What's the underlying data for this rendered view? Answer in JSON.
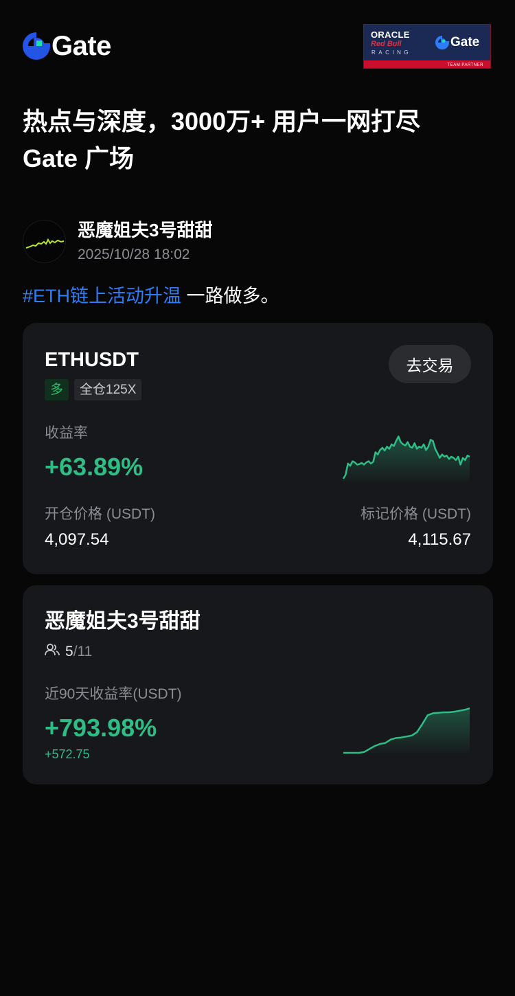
{
  "brand": {
    "name": "Gate",
    "logo_icon": "gate-logo-icon",
    "accent": "#2354e6",
    "accent2": "#17e2ae"
  },
  "partner": {
    "line1": "ORACLE",
    "line2": "Red Bull",
    "line3": "RACING",
    "brand": "Gate",
    "tagline": "TEAM PARTNER"
  },
  "headline": {
    "line1": "热点与深度，3000万+ 用户一网打尽",
    "line2": "Gate 广场"
  },
  "post": {
    "author": "恶魔姐夫3号甜甜",
    "time": "2025/10/28 18:02",
    "hashtag": "#ETH链上活动升温",
    "text": " 一路做多。"
  },
  "position_card": {
    "pair": "ETHUSDT",
    "trade_button": "去交易",
    "side_tag": "多",
    "leverage_tag": "全仓125X",
    "roi_label": "收益率",
    "roi": "+63.89%",
    "entry_label": "开仓价格 (USDT)",
    "entry_price": "4,097.54",
    "mark_label": "标记价格 (USDT)",
    "mark_price": "4,115.67"
  },
  "trader_card": {
    "name": "恶魔姐夫3号甜甜",
    "members_current": "5",
    "members_total": "/11",
    "members_icon": "users-icon",
    "roi_label": "近90天收益率(USDT)",
    "roi": "+793.98%",
    "pnl": "+572.75"
  },
  "colors": {
    "green": "#2ebd85",
    "link": "#2e7cf6",
    "card": "#17181b",
    "bg": "#070708"
  },
  "chart_data": [
    {
      "type": "area",
      "series": [
        {
          "values": [
            0.05,
            0.12,
            0.32,
            0.28,
            0.36,
            0.34,
            0.3,
            0.31,
            0.33,
            0.3,
            0.34,
            0.36,
            0.32,
            0.35,
            0.52,
            0.48,
            0.56,
            0.6,
            0.55,
            0.62,
            0.58,
            0.66,
            0.63,
            0.72,
            0.8,
            0.7,
            0.66,
            0.64,
            0.7,
            0.62,
            0.6,
            0.68,
            0.58,
            0.62,
            0.6,
            0.66,
            0.56,
            0.62,
            0.74,
            0.72,
            0.58,
            0.5,
            0.42,
            0.48,
            0.44,
            0.46,
            0.4,
            0.44,
            0.42,
            0.38,
            0.44,
            0.3,
            0.42,
            0.38,
            0.46,
            0.44
          ]
        }
      ]
    },
    {
      "type": "area",
      "series": [
        {
          "values": [
            0,
            0,
            0,
            0,
            0.02,
            0.08,
            0.14,
            0.18,
            0.2,
            0.27,
            0.3,
            0.31,
            0.33,
            0.35,
            0.42,
            0.58,
            0.76,
            0.8,
            0.81,
            0.82,
            0.82,
            0.83,
            0.85,
            0.87,
            0.9
          ]
        }
      ]
    }
  ]
}
